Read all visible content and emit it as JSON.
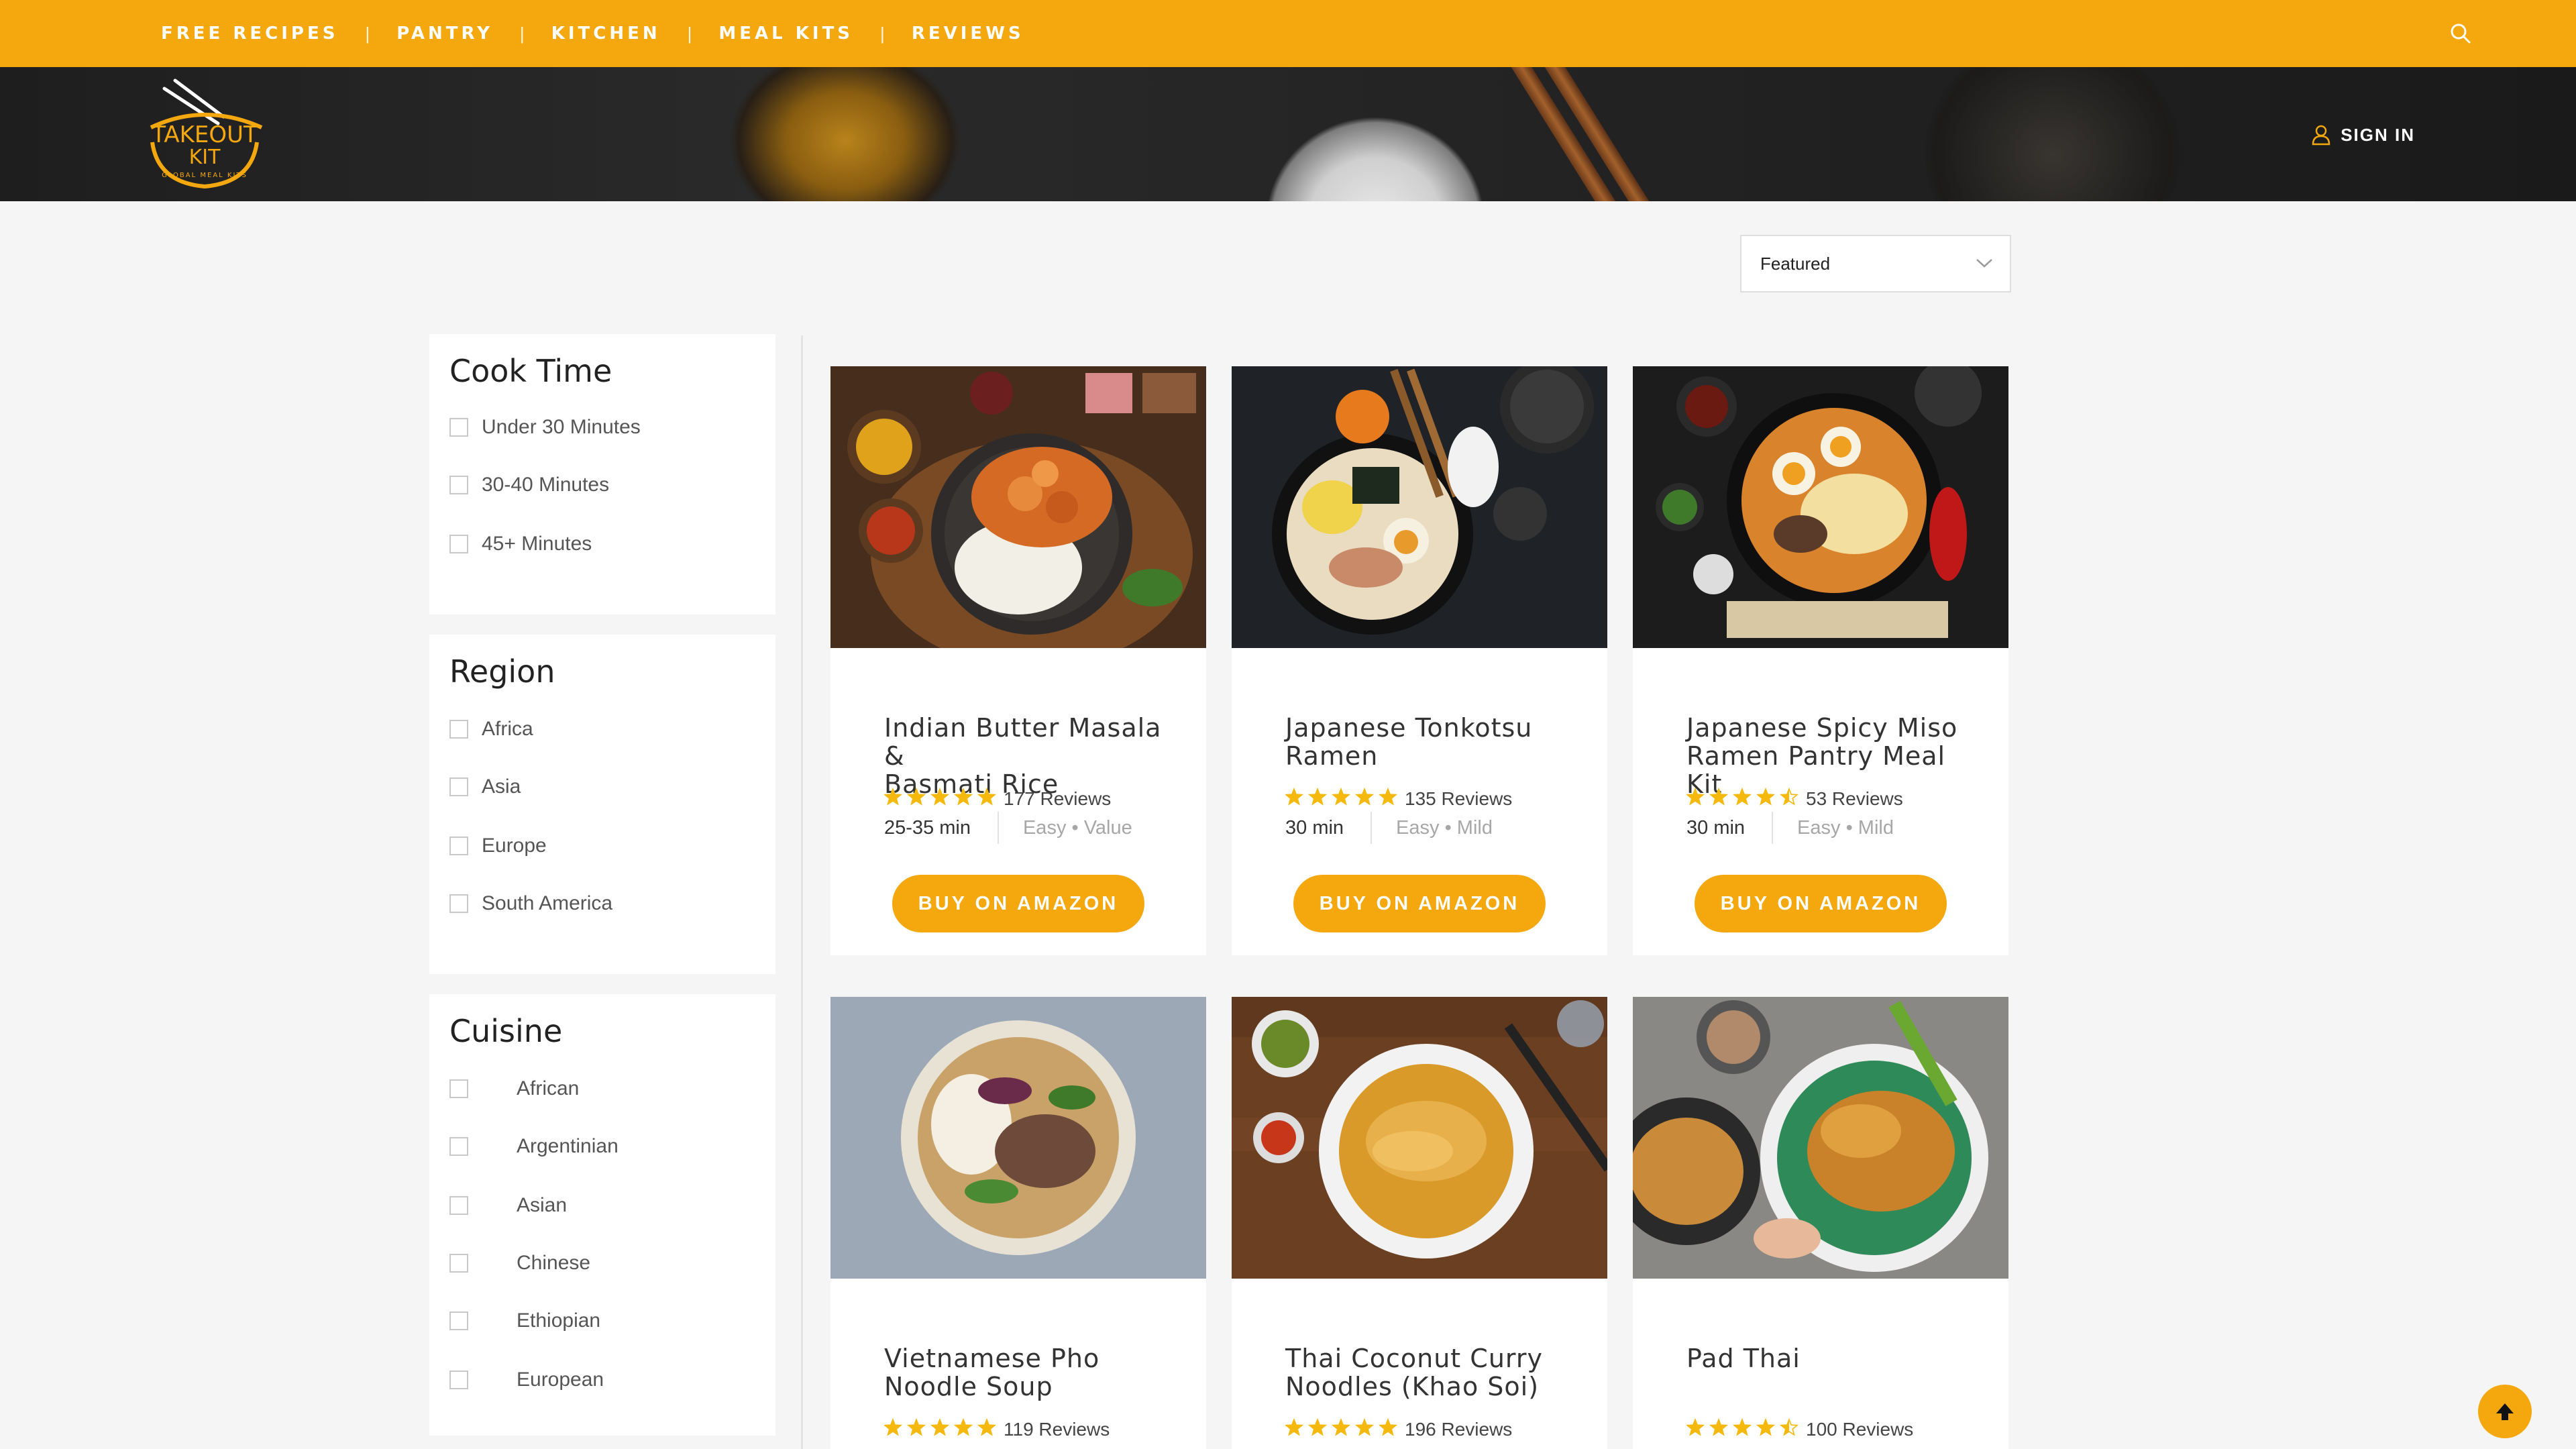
{
  "nav": {
    "items": [
      "FREE RECIPES",
      "PANTRY",
      "KITCHEN",
      "MEAL KITS",
      "REVIEWS"
    ],
    "separator": "|",
    "search_icon": "search-icon"
  },
  "brand": {
    "logo_text": "TAKEOUT KIT",
    "logo_sub": "GLOBAL MEAL KITS"
  },
  "account": {
    "signin_label": "SIGN IN",
    "icon": "user-icon"
  },
  "sort": {
    "selected": "Featured"
  },
  "filters": {
    "cook_time": {
      "title": "Cook Time",
      "options": [
        "Under 30 Minutes",
        "30-40 Minutes",
        "45+ Minutes"
      ]
    },
    "region": {
      "title": "Region",
      "options": [
        "Africa",
        "Asia",
        "Europe",
        "South America"
      ]
    },
    "cuisine": {
      "title": "Cuisine",
      "options": [
        "African",
        "Argentinian",
        "Asian",
        "Chinese",
        "Ethiopian",
        "European"
      ]
    }
  },
  "products": [
    {
      "title_line1": "Indian Butter Masala &",
      "title_line2": "Basmati Rice",
      "rating": 5,
      "reviews": "177 Reviews",
      "time": "25-35 min",
      "tags": "Easy • Value",
      "button": "BUY ON AMAZON"
    },
    {
      "title_line1": "Japanese Tonkotsu",
      "title_line2": "Ramen",
      "rating": 5,
      "reviews": "135 Reviews",
      "time": "30 min",
      "tags": "Easy • Mild",
      "button": "BUY ON AMAZON"
    },
    {
      "title_line1": "Japanese Spicy Miso",
      "title_line2": "Ramen Pantry Meal Kit",
      "rating": 4.5,
      "reviews": "53 Reviews",
      "time": "30 min",
      "tags": "Easy • Mild",
      "button": "BUY ON AMAZON"
    },
    {
      "title_line1": "Vietnamese Pho",
      "title_line2": "Noodle Soup",
      "rating": 5,
      "reviews": "119 Reviews"
    },
    {
      "title_line1": "Thai Coconut Curry",
      "title_line2": "Noodles (Khao Soi)",
      "rating": 5,
      "reviews": "196 Reviews"
    },
    {
      "title_line1": "Pad Thai",
      "title_line2": "",
      "rating": 4.5,
      "reviews": "100 Reviews"
    }
  ],
  "colors": {
    "accent": "#f5a80e",
    "star": "#f5b90e"
  }
}
